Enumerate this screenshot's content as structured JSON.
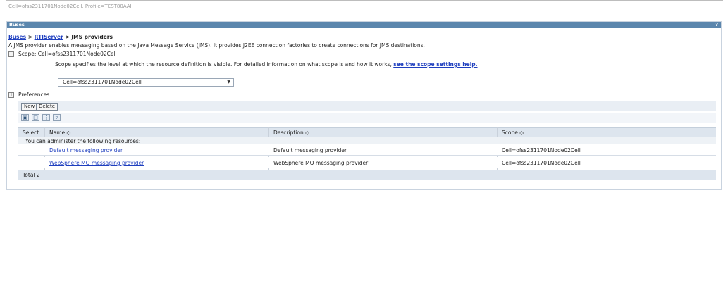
{
  "context": "Cell=ofss2311701Node02Cell, Profile=TEST80AAI",
  "panel": {
    "title": "Buses",
    "help": "?"
  },
  "breadcrumb": {
    "link1": "Buses",
    "sep": ">",
    "link2": "RTIServer",
    "current": "JMS providers"
  },
  "description": "A JMS provider enables messaging based on the Java Message Service (JMS). It provides J2EE connection factories to create connections for JMS destinations.",
  "scope": {
    "toggle": "-",
    "label": "Scope: Cell=ofss2311701Node02Cell",
    "help_text": "Scope specifies the level at which the resource definition is visible. For detailed information on what scope is and how it works,",
    "help_link": "see the scope settings help.",
    "selected": "Cell=ofss2311701Node02Cell"
  },
  "preferences": {
    "toggle": "+",
    "label": "Preferences"
  },
  "toolbar": {
    "new_label": "New",
    "delete_label": "Delete"
  },
  "icons": [
    "select-all-icon",
    "deselect-all-icon",
    "show-filter-icon",
    "clear-filter-icon"
  ],
  "table": {
    "columns": {
      "select": "Select",
      "name": "Name ◇",
      "description": "Description ◇",
      "scope": "Scope ◇"
    },
    "group_label": "You can administer the following resources:",
    "rows": [
      {
        "name": "Default messaging provider",
        "description": "Default messaging provider",
        "scope": "Cell=ofss2311701Node02Cell"
      },
      {
        "name": "WebSphere MQ messaging provider",
        "description": "WebSphere MQ messaging provider",
        "scope": "Cell=ofss2311701Node02Cell"
      }
    ],
    "total": "Total 2"
  },
  "colors": {
    "header": "#5b86ad",
    "link": "#1f3fbf",
    "table_head": "#dde5ee"
  }
}
